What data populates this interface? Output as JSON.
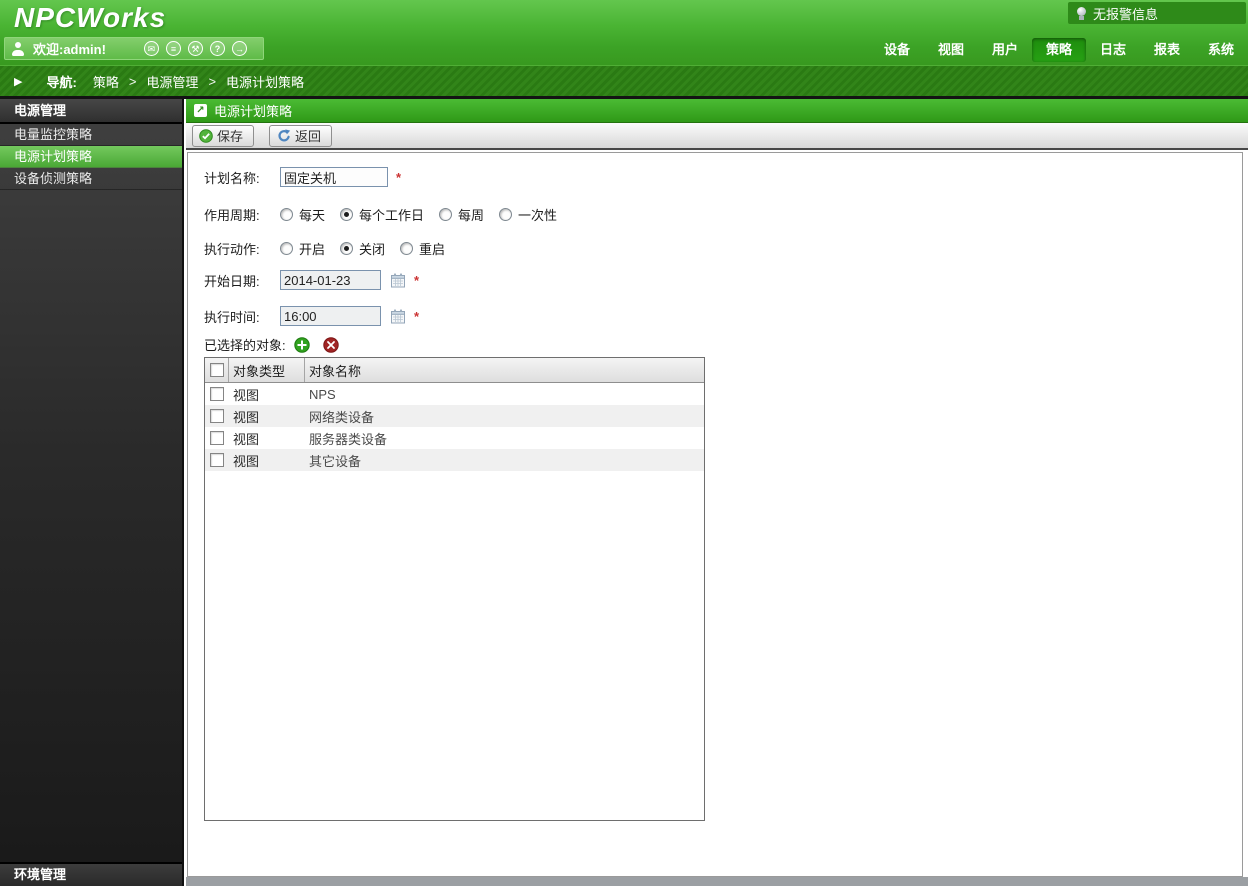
{
  "header": {
    "logo": "NPCWorks",
    "alarm_status": "无报警信息"
  },
  "userbar": {
    "welcome": "欢迎:admin!",
    "icons": [
      "mail-icon",
      "list-icon",
      "tools-icon",
      "help-icon",
      "logout-icon"
    ]
  },
  "tabs": [
    {
      "label": "设备",
      "active": false
    },
    {
      "label": "视图",
      "active": false
    },
    {
      "label": "用户",
      "active": false
    },
    {
      "label": "策略",
      "active": true
    },
    {
      "label": "日志",
      "active": false
    },
    {
      "label": "报表",
      "active": false
    },
    {
      "label": "系统",
      "active": false
    }
  ],
  "breadcrumb": {
    "prefix": "导航:",
    "separator": ">",
    "items": [
      "策略",
      "电源管理",
      "电源计划策略"
    ]
  },
  "sidebar": {
    "top_section": "电源管理",
    "items": [
      {
        "label": "电量监控策略",
        "selected": false
      },
      {
        "label": "电源计划策略",
        "selected": true
      },
      {
        "label": "设备侦测策略",
        "selected": false
      }
    ],
    "bottom_section": "环境管理"
  },
  "content": {
    "title": "电源计划策略",
    "toolbar": {
      "save": "保存",
      "back": "返回"
    },
    "form": {
      "plan_name": {
        "label": "计划名称:",
        "value": "固定关机",
        "required_mark": "*"
      },
      "cycle": {
        "label": "作用周期:",
        "options": [
          {
            "label": "每天",
            "checked": false
          },
          {
            "label": "每个工作日",
            "checked": true
          },
          {
            "label": "每周",
            "checked": false
          },
          {
            "label": "一次性",
            "checked": false
          }
        ]
      },
      "action": {
        "label": "执行动作:",
        "options": [
          {
            "label": "开启",
            "checked": false
          },
          {
            "label": "关闭",
            "checked": true
          },
          {
            "label": "重启",
            "checked": false
          }
        ]
      },
      "start_date": {
        "label": "开始日期:",
        "value": "2014-01-23",
        "required_mark": "*"
      },
      "exec_time": {
        "label": "执行时间:",
        "value": "16:00",
        "required_mark": "*"
      },
      "selected_objects_label": "已选择的对象:"
    },
    "table": {
      "columns": [
        "对象类型",
        "对象名称"
      ],
      "rows": [
        {
          "checked": false,
          "type": "视图",
          "name": "NPS"
        },
        {
          "checked": false,
          "type": "视图",
          "name": "网络类设备"
        },
        {
          "checked": false,
          "type": "视图",
          "name": "服务器类设备"
        },
        {
          "checked": false,
          "type": "视图",
          "name": "其它设备"
        }
      ]
    }
  },
  "colors": {
    "accent_green": "#3aa124",
    "active_tab": "#1f8d0e",
    "selected_item": "#5cb548",
    "required_red": "#cc3333"
  }
}
